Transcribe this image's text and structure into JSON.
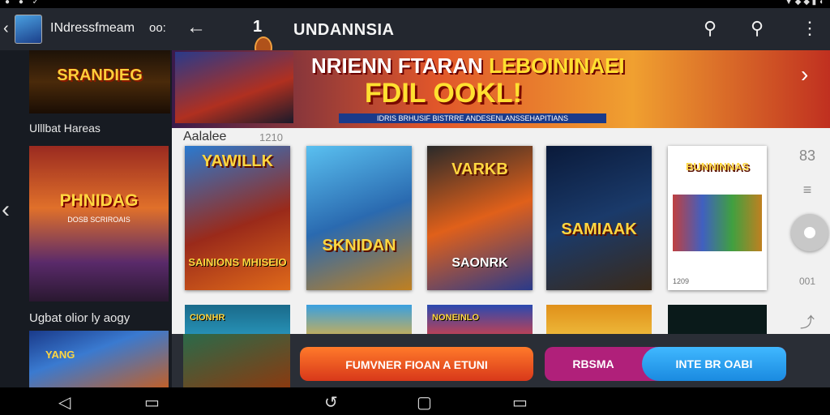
{
  "left_panel": {
    "title": "INdressfmeam",
    "more": "oo:",
    "banner_title": "SRANDIEG",
    "section1_title": "Ulllbat Hareas",
    "poster_title": "PHNIDAG",
    "poster_subtitle": "DOSB SCRIROAIS",
    "section2_title": "Ugbat olior ly aogy",
    "bottom_title": "YANG"
  },
  "header": {
    "logo_text": "1",
    "title": "UNDANNSIA"
  },
  "hero": {
    "line1_white": "NRIENN FTARAN",
    "line1_yellow": "LEBOININAEI",
    "line2": "FDIL OOKL!",
    "strip": "IDRIS BRHUSIF BISTRRE ANDESENLANSSEHAPITIANS"
  },
  "section": {
    "title": "Aalalee",
    "count": "1210"
  },
  "games": [
    {
      "name": "YAWILLK",
      "tag": "SAINIONS MHISEIO"
    },
    {
      "name": "SKNIDAN",
      "tag": ""
    },
    {
      "name": "VARKB",
      "tag": "SAONRK"
    },
    {
      "name": "SAMIAAK",
      "tag": ""
    },
    {
      "name": "BUNNINNAS",
      "tag": ""
    }
  ],
  "game5_meta": "1209",
  "row2": [
    "CIONHR",
    "",
    "NONEINLO",
    "",
    ""
  ],
  "side": {
    "top_label": "83",
    "bottom_label": "001"
  },
  "buttons": {
    "primary": "FUMVNER FIOAN A ETUNI",
    "split_left": "RBSMA",
    "split_right": "INTE BR OABI"
  },
  "colors": {
    "header_bg": "#23272f",
    "primary_button": "#f0561e",
    "split_button_left": "#b0207a",
    "split_button_right": "#2aa0f0"
  },
  "icons": [
    "back-icon",
    "search-icon",
    "more-vert-icon",
    "chevron-right-icon",
    "chevron-left-icon",
    "menu-icon",
    "share-icon"
  ]
}
